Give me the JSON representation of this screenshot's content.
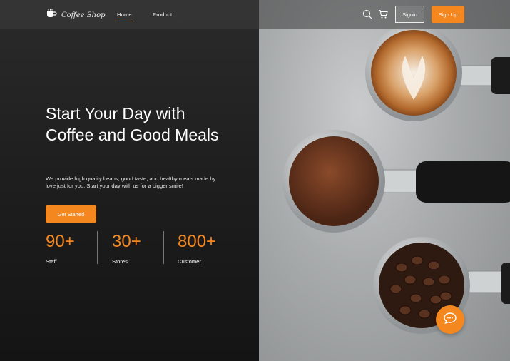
{
  "brand": {
    "name": "Coffee Shop",
    "accent": "#f5871f"
  },
  "nav": {
    "links": [
      {
        "label": "Home",
        "active": true
      },
      {
        "label": "Product",
        "active": false
      }
    ],
    "icons": [
      "search-icon",
      "cart-icon"
    ],
    "signin_label": "Signin",
    "signup_label": "Sign Up"
  },
  "hero": {
    "title": "Start Your Day with Coffee and Good Meals",
    "subtitle": "We provide high quality beans, good taste, and healthy meals made by love just for you. Start your day with us for a bigger smile!",
    "cta_label": "Get Started"
  },
  "stats": [
    {
      "value": "90+",
      "label": "Staff"
    },
    {
      "value": "30+",
      "label": "Stores"
    },
    {
      "value": "800+",
      "label": "Customer"
    }
  ],
  "chat": {
    "icon": "chat-icon"
  }
}
